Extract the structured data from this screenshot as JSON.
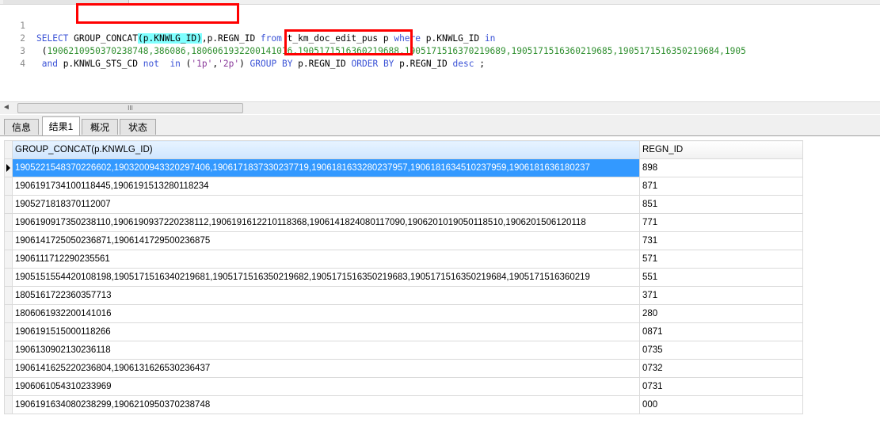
{
  "editor": {
    "lines": [
      {
        "num": "1"
      },
      {
        "num": "2"
      },
      {
        "num": "3"
      },
      {
        "num": "4"
      }
    ],
    "line1": {
      "kw_select": "SELECT",
      "fn": "GROUP_CONCAT",
      "arg": "(p.KNWLG_ID)",
      "rest1": ",p.REGN_ID ",
      "kw_from": "from",
      "table": " t_km_doc_edit_pus p ",
      "kw_where": "where",
      "col": " p.KNWLG_ID ",
      "kw_in": "in"
    },
    "line2": {
      "open": " (",
      "ids": "1906210950370238748,386086,1806061932200141016,1905171516360219688,1905171516370219689,1905171516360219685,1905171516350219684,1905"
    },
    "line3": {
      "kw_and": " and",
      "col": " p.KNWLG_STS_CD ",
      "kw_not": "not",
      "sp": "  ",
      "kw_in": "in",
      "open": " (",
      "s1": "'1p'",
      "comma": ",",
      "s2": "'2p'",
      "close": ") ",
      "kw_group": "GROUP BY",
      "grp_col": " p.REGN_ID ",
      "kw_order": "ORDER BY",
      "ord_col": " p.REGN_ID ",
      "kw_desc": "desc",
      "end": " ;"
    }
  },
  "scrollbar": {
    "left_arrow": "◄",
    "thumb_grip": "III"
  },
  "tabs": [
    {
      "label": "信息"
    },
    {
      "label": "结果1"
    },
    {
      "label": "概况"
    },
    {
      "label": "状态"
    }
  ],
  "grid": {
    "columns": [
      "GROUP_CONCAT(p.KNWLG_ID)",
      "REGN_ID"
    ],
    "rows": [
      {
        "ids": "1905221548370226602,1903200943320297406,1906171837330237719,1906181633280237957,1906181634510237959,1906181636180237",
        "regn": "898"
      },
      {
        "ids": "1906191734100118445,1906191513280118234",
        "regn": "871"
      },
      {
        "ids": "1905271818370112007",
        "regn": "851"
      },
      {
        "ids": "1906190917350238110,1906190937220238112,1906191612210118368,1906141824080117090,1906201019050118510,1906201506120118",
        "regn": "771"
      },
      {
        "ids": "1906141725050236871,1906141729500236875",
        "regn": "731"
      },
      {
        "ids": "1906111712290235561",
        "regn": "571"
      },
      {
        "ids": "1905151554420108198,1905171516340219681,1905171516350219682,1905171516350219683,1905171516350219684,1905171516360219",
        "regn": "551"
      },
      {
        "ids": "1805161722360357713",
        "regn": "371"
      },
      {
        "ids": "1806061932200141016",
        "regn": "280"
      },
      {
        "ids": "1906191515000118266",
        "regn": "0871"
      },
      {
        "ids": "1906130902130236118",
        "regn": "0735"
      },
      {
        "ids": "1906141625220236804,1906131626530236437",
        "regn": "0732"
      },
      {
        "ids": "1906061054310233969",
        "regn": "0731"
      },
      {
        "ids": "1906191634080238299,1906210950370238748",
        "regn": "000"
      }
    ]
  }
}
